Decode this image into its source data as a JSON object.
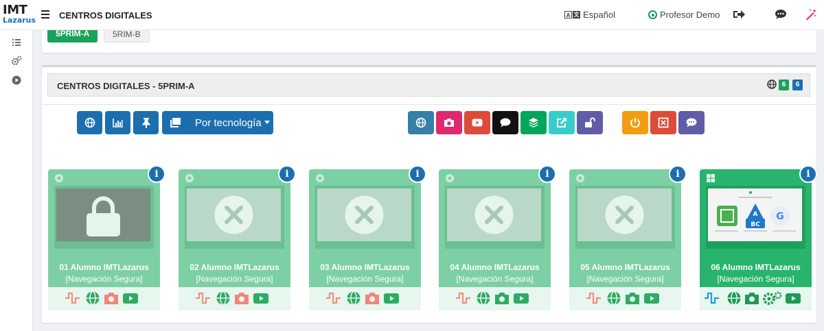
{
  "brand": {
    "logo_top": "IMT",
    "logo_bottom": "Lazarus"
  },
  "header": {
    "title": "CENTROS DIGITALES",
    "language": "Español",
    "user": "Profesor Demo"
  },
  "groups": {
    "active": "5PRIM-A",
    "other": "5RIM-B"
  },
  "panel": {
    "title": "CENTROS DIGITALES - 5PRIM-A",
    "badge_green": "6",
    "badge_blue": "6",
    "tech_button": "Por tecnología"
  },
  "colors": {
    "accent": "#1c6fae",
    "success": "#19a259",
    "tile": "#7dd0a4",
    "tile_active": "#28b46d"
  },
  "students": [
    {
      "name": "01 Alumno IMTLazarus",
      "status": "[Navegación Segura]",
      "os": "chrome-icon",
      "screen": "locked"
    },
    {
      "name": "02 Alumno IMTLazarus",
      "status": "[Navegación Segura]",
      "os": "chrome-icon",
      "screen": "unavailable"
    },
    {
      "name": "03 Alumno IMTLazarus",
      "status": "[Navegación Segura]",
      "os": "chrome-icon",
      "screen": "unavailable"
    },
    {
      "name": "04 Alumno IMTLazarus",
      "status": "[Navegación Segura]",
      "os": "chrome-icon",
      "screen": "unavailable"
    },
    {
      "name": "05 Alumno IMTLazarus",
      "status": "[Navegación Segura]",
      "os": "chrome-icon",
      "screen": "unavailable"
    },
    {
      "name": "06 Alumno IMTLazarus",
      "status": "[Navegación Segura]",
      "os": "windows-icon",
      "screen": "live"
    }
  ]
}
